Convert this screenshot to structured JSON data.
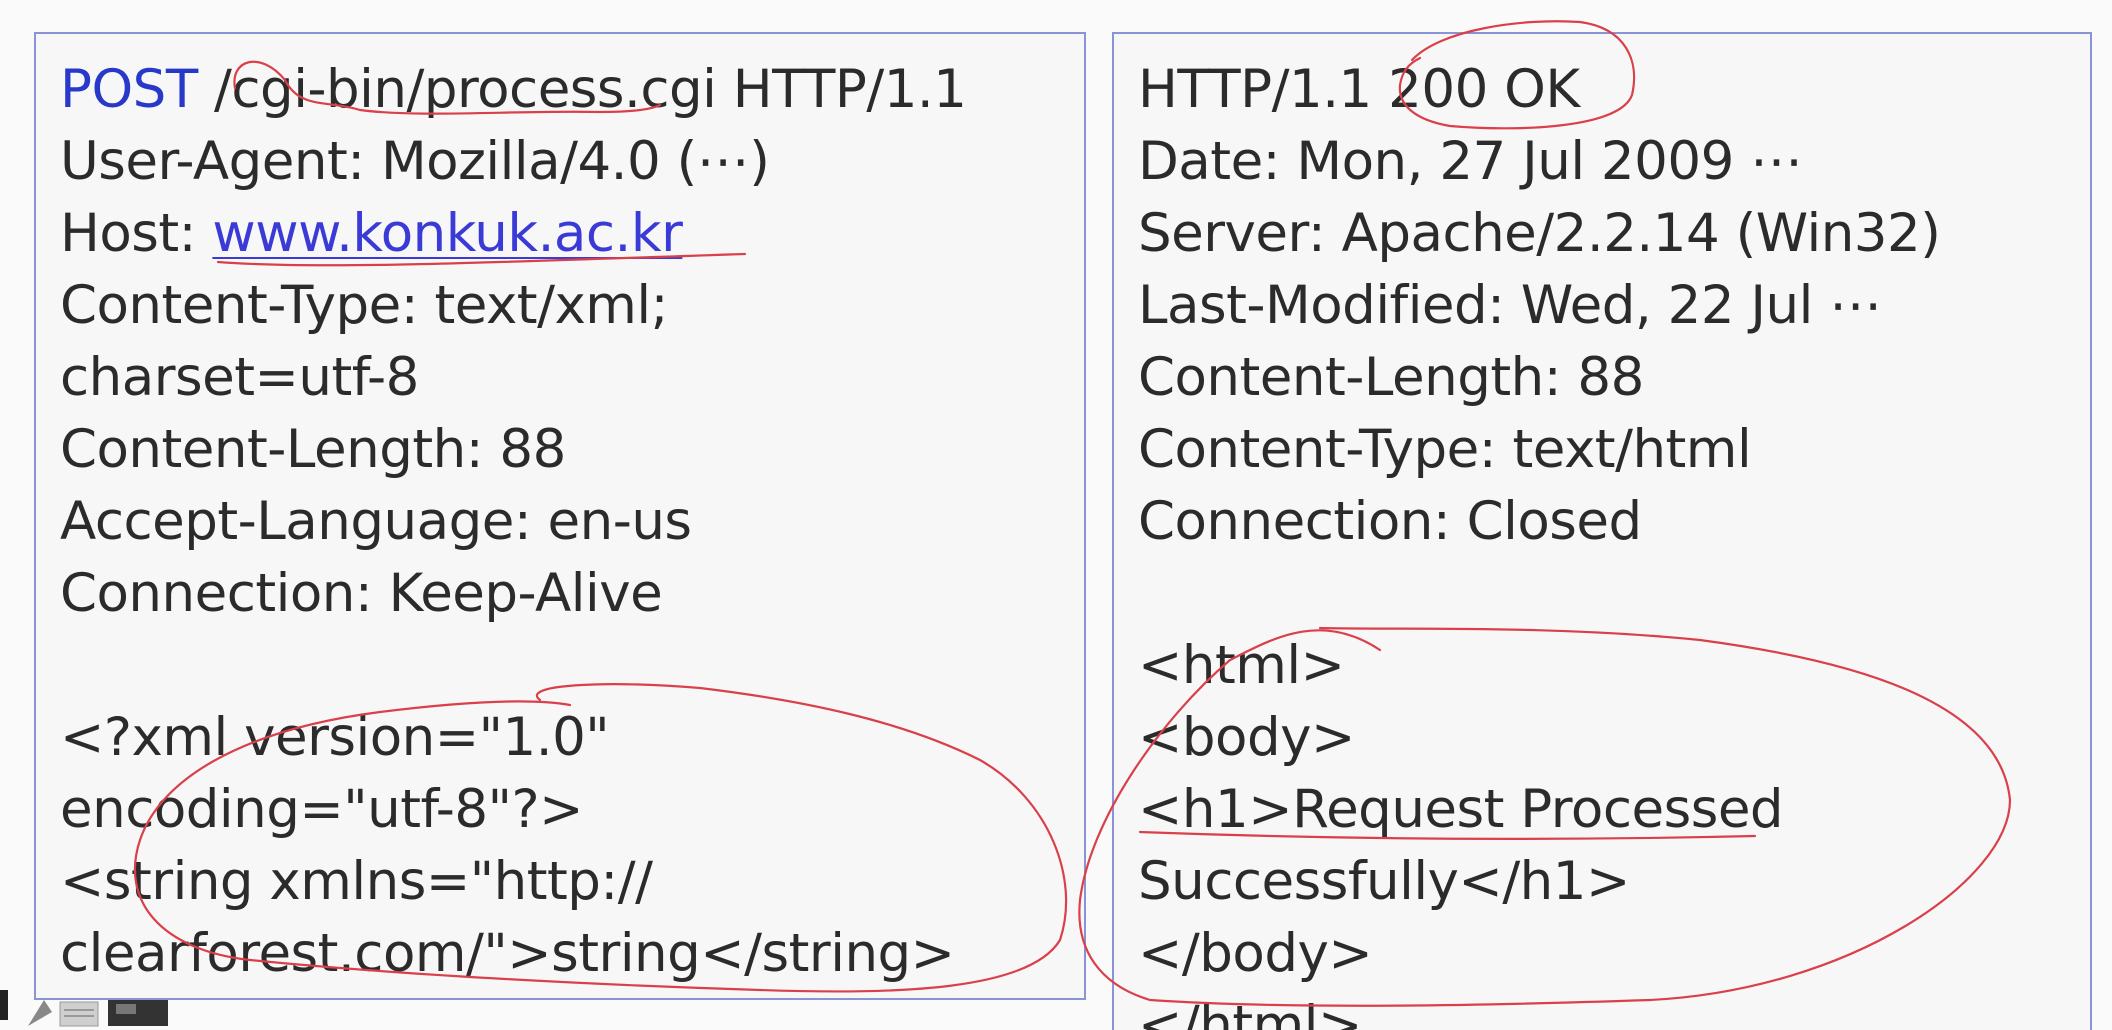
{
  "request": {
    "line1_method": "POST",
    "line1_rest": " /cgi-bin/process.cgi HTTP/1.1",
    "user_agent": "User-Agent: Mozilla/4.0 (⋯)",
    "host_label": "Host: ",
    "host_link": "www.konkuk.ac.kr",
    "content_type": "Content-Type: text/xml;",
    "charset": "charset=utf-8",
    "content_length": "Content-Length: 88",
    "accept_language": "Accept-Language: en-us",
    "connection": "Connection: Keep-Alive",
    "body_line1": "<?xml version=\"1.0\"",
    "body_line2": "encoding=\"utf-8\"?>",
    "body_line3": "<string xmlns=\"http://",
    "body_line4": "clearforest.com/\">string</string>"
  },
  "response": {
    "status_prefix": "HTTP/1.1 ",
    "status": "200 OK",
    "date": "Date: Mon, 27 Jul 2009 ⋯",
    "server": "Server: Apache/2.2.14 (Win32)",
    "last_modified": "Last-Modified: Wed, 22 Jul ⋯",
    "content_length": "Content-Length: 88",
    "content_type": "Content-Type: text/html",
    "connection": "Connection: Closed",
    "body_line1": "<html>",
    "body_line2": "<body>",
    "body_line3": "<h1>Request Processed",
    "body_line4": "Successfully</h1>",
    "body_line5": "</body>",
    "body_line6": "</html>"
  },
  "colors": {
    "method_blue": "#2838c8",
    "link_blue": "#3a3ad6",
    "panel_border": "#8a93d6",
    "annotation_red": "#d9404a"
  }
}
